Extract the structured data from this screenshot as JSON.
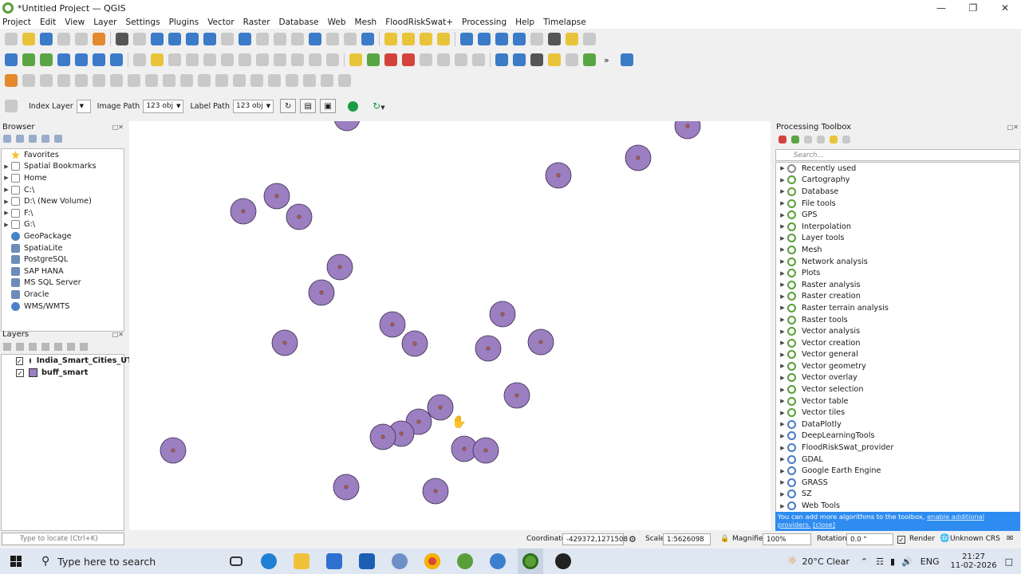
{
  "window": {
    "title": "*Untitled Project — QGIS"
  },
  "menu": [
    "Project",
    "Edit",
    "View",
    "Layer",
    "Settings",
    "Plugins",
    "Vector",
    "Raster",
    "Database",
    "Web",
    "Mesh",
    "FloodRiskSwat+",
    "Processing",
    "Help",
    "Timelapse"
  ],
  "plugin_toolbar": {
    "index_layer_label": "Index Layer",
    "image_path_label": "Image Path",
    "image_path_value": "123 obj",
    "label_path_label": "Label Path",
    "label_path_value": "123 obj"
  },
  "browser": {
    "title": "Browser",
    "items": [
      {
        "label": "Favorites",
        "icon": "star-icon",
        "expand": false
      },
      {
        "label": "Spatial Bookmarks",
        "icon": "bookmark-icon",
        "expand": true
      },
      {
        "label": "Home",
        "icon": "folder-icon",
        "expand": true
      },
      {
        "label": "C:\\",
        "icon": "folder-icon",
        "expand": true
      },
      {
        "label": "D:\\ (New Volume)",
        "icon": "folder-icon",
        "expand": true
      },
      {
        "label": "F:\\",
        "icon": "folder-icon",
        "expand": true
      },
      {
        "label": "G:\\",
        "icon": "folder-icon",
        "expand": true
      },
      {
        "label": "GeoPackage",
        "icon": "geopackage-icon",
        "expand": false
      },
      {
        "label": "SpatiaLite",
        "icon": "spatialite-icon",
        "expand": false
      },
      {
        "label": "PostgreSQL",
        "icon": "postgresql-icon",
        "expand": false
      },
      {
        "label": "SAP HANA",
        "icon": "sap-hana-icon",
        "expand": false
      },
      {
        "label": "MS SQL Server",
        "icon": "mssql-icon",
        "expand": false
      },
      {
        "label": "Oracle",
        "icon": "oracle-icon",
        "expand": false
      },
      {
        "label": "WMS/WMTS",
        "icon": "wms-icon",
        "expand": false
      }
    ]
  },
  "layers": {
    "title": "Layers",
    "items": [
      {
        "label": "India_Smart_Cities_UT",
        "checked": true,
        "symbol": "point"
      },
      {
        "label": "buff_smart",
        "checked": true,
        "symbol": "polygon"
      }
    ]
  },
  "locate": {
    "placeholder": "Type to locate (Ctrl+K)"
  },
  "map": {
    "fill_color": "#9b7fc1",
    "outline_color": "#3a2b4d",
    "point_color": "#b65a4a"
  },
  "toolbox": {
    "title": "Processing Toolbox",
    "search_placeholder": "Search...",
    "items": [
      {
        "label": "Recently used",
        "icon": "clock-icon"
      },
      {
        "label": "Cartography",
        "icon": "qgis-icon"
      },
      {
        "label": "Database",
        "icon": "qgis-icon"
      },
      {
        "label": "File tools",
        "icon": "qgis-icon"
      },
      {
        "label": "GPS",
        "icon": "qgis-icon"
      },
      {
        "label": "Interpolation",
        "icon": "qgis-icon"
      },
      {
        "label": "Layer tools",
        "icon": "qgis-icon"
      },
      {
        "label": "Mesh",
        "icon": "qgis-icon"
      },
      {
        "label": "Network analysis",
        "icon": "qgis-icon"
      },
      {
        "label": "Plots",
        "icon": "qgis-icon"
      },
      {
        "label": "Raster analysis",
        "icon": "qgis-icon"
      },
      {
        "label": "Raster creation",
        "icon": "qgis-icon"
      },
      {
        "label": "Raster terrain analysis",
        "icon": "qgis-icon"
      },
      {
        "label": "Raster tools",
        "icon": "qgis-icon"
      },
      {
        "label": "Vector analysis",
        "icon": "qgis-icon"
      },
      {
        "label": "Vector creation",
        "icon": "qgis-icon"
      },
      {
        "label": "Vector general",
        "icon": "qgis-icon"
      },
      {
        "label": "Vector geometry",
        "icon": "qgis-icon"
      },
      {
        "label": "Vector overlay",
        "icon": "qgis-icon"
      },
      {
        "label": "Vector selection",
        "icon": "qgis-icon"
      },
      {
        "label": "Vector table",
        "icon": "qgis-icon"
      },
      {
        "label": "Vector tiles",
        "icon": "qgis-icon"
      },
      {
        "label": "DataPlotly",
        "icon": "dataplotly-icon"
      },
      {
        "label": "DeepLearningTools",
        "icon": "gear-icon"
      },
      {
        "label": "FloodRiskSwat_provider",
        "icon": "gear-icon"
      },
      {
        "label": "GDAL",
        "icon": "gdal-icon"
      },
      {
        "label": "Google Earth Engine",
        "icon": "earth-engine-icon"
      },
      {
        "label": "GRASS",
        "icon": "grass-icon"
      },
      {
        "label": "SZ",
        "icon": "sz-icon"
      },
      {
        "label": "Web Tools",
        "icon": "gear-icon"
      }
    ],
    "tip_text": "You can add more algorithms to the toolbox, ",
    "tip_link": "enable additional providers.",
    "tip_close": "[close]"
  },
  "statusbar": {
    "coordinate_label": "Coordinate",
    "coordinate_value": "-429372,1271508",
    "scale_label": "Scale",
    "scale_value": "1:5626098",
    "magnifier_label": "Magnifier",
    "magnifier_value": "100%",
    "rotation_label": "Rotation",
    "rotation_value": "0.0 °",
    "render_label": "Render",
    "crs_label": "Unknown CRS"
  },
  "taskbar": {
    "search_placeholder": "Type here to search",
    "weather": "20°C  Clear",
    "language": "ENG",
    "time": "21:27",
    "date": "11-02-2026"
  }
}
